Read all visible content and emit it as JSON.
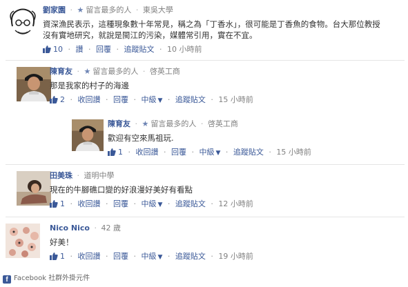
{
  "comments": [
    {
      "name": "劉家園",
      "badge": "留言最多的人",
      "school": "東吳大學",
      "text_lines": [
        "資深漁民表示，這種現象數十年常見，稱之為「丁香水」，很可能是丁香魚的食物。台大那位教授",
        "沒有實地研究，就說是閩江的污染，媒體常引用，實在不宜。"
      ],
      "likes": "10",
      "action1": "讚",
      "reply": "回覆",
      "follow": "追蹤貼文",
      "time": "10 小時前"
    },
    {
      "name": "陳育友",
      "badge": "留言最多的人",
      "school": "啓英工商",
      "text": "那是我家的村子的海邊",
      "likes": "2",
      "action1": "收回讚",
      "reply": "回覆",
      "zhongji": "中級",
      "follow": "追蹤貼文",
      "time": "15 小時前"
    },
    {
      "name": "陳育友",
      "badge": "留言最多的人",
      "school": "啓英工商",
      "text": "歡迎有空來馬祖玩.",
      "likes": "1",
      "action1": "收回讚",
      "reply": "回覆",
      "zhongji": "中級",
      "follow": "追蹤貼文",
      "time": "15 小時前"
    },
    {
      "name": "田美珠",
      "school": "道明中學",
      "text": "現在的牛腳礁口變的好浪漫好美好有看點",
      "likes": "1",
      "action1": "收回讚",
      "reply": "回覆",
      "zhongji": "中級",
      "follow": "追蹤貼文",
      "time": "12 小時前"
    },
    {
      "name": "Nico Nico",
      "age": "42 歲",
      "text": "好美！",
      "likes": "1",
      "action1": "收回讚",
      "reply": "回覆",
      "zhongji": "中級",
      "follow": "追蹤貼文",
      "time": "19 小時前"
    }
  ],
  "footer": {
    "brand": "Facebook",
    "plugin": "社群外掛元件"
  },
  "colors": {
    "link": "#3b5998",
    "muted": "#808080",
    "divider": "#e5e5e5"
  }
}
